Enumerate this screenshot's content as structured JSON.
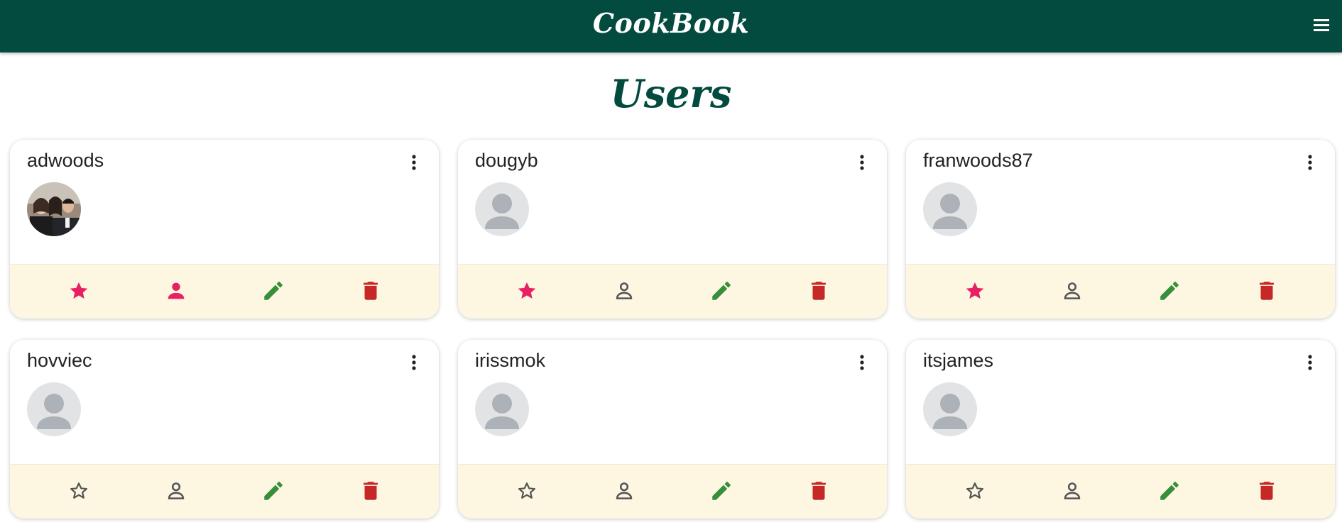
{
  "app": {
    "title": "CookBook"
  },
  "page": {
    "title": "Users"
  },
  "colors": {
    "header": "#024b3e",
    "favorite_active": "#e91e63",
    "inactive_icon": "#555555",
    "edit": "#388e3c",
    "delete": "#c62828",
    "card_footer": "#fdf6e1"
  },
  "users": [
    {
      "username": "adwoods",
      "avatar": "photo",
      "favorite": true,
      "profile_active": true
    },
    {
      "username": "dougyb",
      "avatar": "default",
      "favorite": true,
      "profile_active": false
    },
    {
      "username": "franwoods87",
      "avatar": "default",
      "favorite": true,
      "profile_active": false
    },
    {
      "username": "hovviec",
      "avatar": "default",
      "favorite": false,
      "profile_active": false
    },
    {
      "username": "irissmok",
      "avatar": "default",
      "favorite": false,
      "profile_active": false
    },
    {
      "username": "itsjames",
      "avatar": "default",
      "favorite": false,
      "profile_active": false
    }
  ]
}
